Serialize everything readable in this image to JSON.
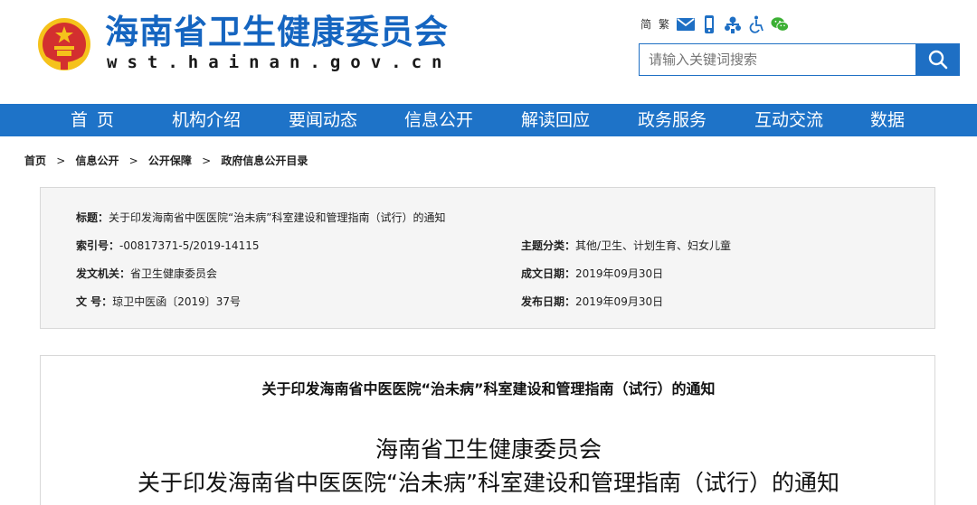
{
  "header": {
    "site_title": "海南省卫生健康委员会",
    "site_domain": "wst.hainan.gov.cn",
    "emblem_icon": "national-emblem-icon",
    "tools": {
      "simplified_label": "简",
      "traditional_label": "繁",
      "icons": [
        "mail-icon",
        "mobile-icon",
        "network-icon",
        "accessibility-icon",
        "wechat-icon"
      ]
    },
    "search": {
      "placeholder": "请输入关键词搜索",
      "button_icon": "search-icon"
    }
  },
  "nav": {
    "items": [
      {
        "label": "首  页"
      },
      {
        "label": "机构介绍"
      },
      {
        "label": "要闻动态"
      },
      {
        "label": "信息公开"
      },
      {
        "label": "解读回应"
      },
      {
        "label": "政务服务"
      },
      {
        "label": "互动交流"
      },
      {
        "label": "数据"
      }
    ]
  },
  "breadcrumb": {
    "items": [
      "首页",
      "信息公开",
      "公开保障",
      "政府信息公开目录"
    ],
    "separator": ">"
  },
  "meta": {
    "title_label": "标题：",
    "title_value": "关于印发海南省中医医院“治未病”科室建设和管理指南（试行）的通知",
    "index_label": "索引号：",
    "index_value": "-00817371-5/2019-14115",
    "topic_label": "主题分类：",
    "topic_value": "其他/卫生、计划生育、妇女儿童",
    "issuer_label": "发文机关：",
    "issuer_value": "省卫生健康委员会",
    "created_label": "成文日期：",
    "created_value": "2019年09月30日",
    "docno_label": "文 号：",
    "docno_value": "琼卫中医函〔2019〕37号",
    "published_label": "发布日期：",
    "published_value": "2019年09月30日"
  },
  "content": {
    "doc_title": "关于印发海南省中医医院“治未病”科室建设和管理指南（试行）的通知",
    "org_line": "海南省卫生健康委员会",
    "subject_line": "关于印发海南省中医医院“治未病”科室建设和管理指南（试行）的通知"
  },
  "colors": {
    "brand_blue": "#1565c0",
    "nav_blue": "#1e73c8",
    "search_blue": "#1e6fc4",
    "emblem_red": "#d32f2f",
    "emblem_gold": "#f5c21b",
    "wechat_green": "#3cb034"
  }
}
